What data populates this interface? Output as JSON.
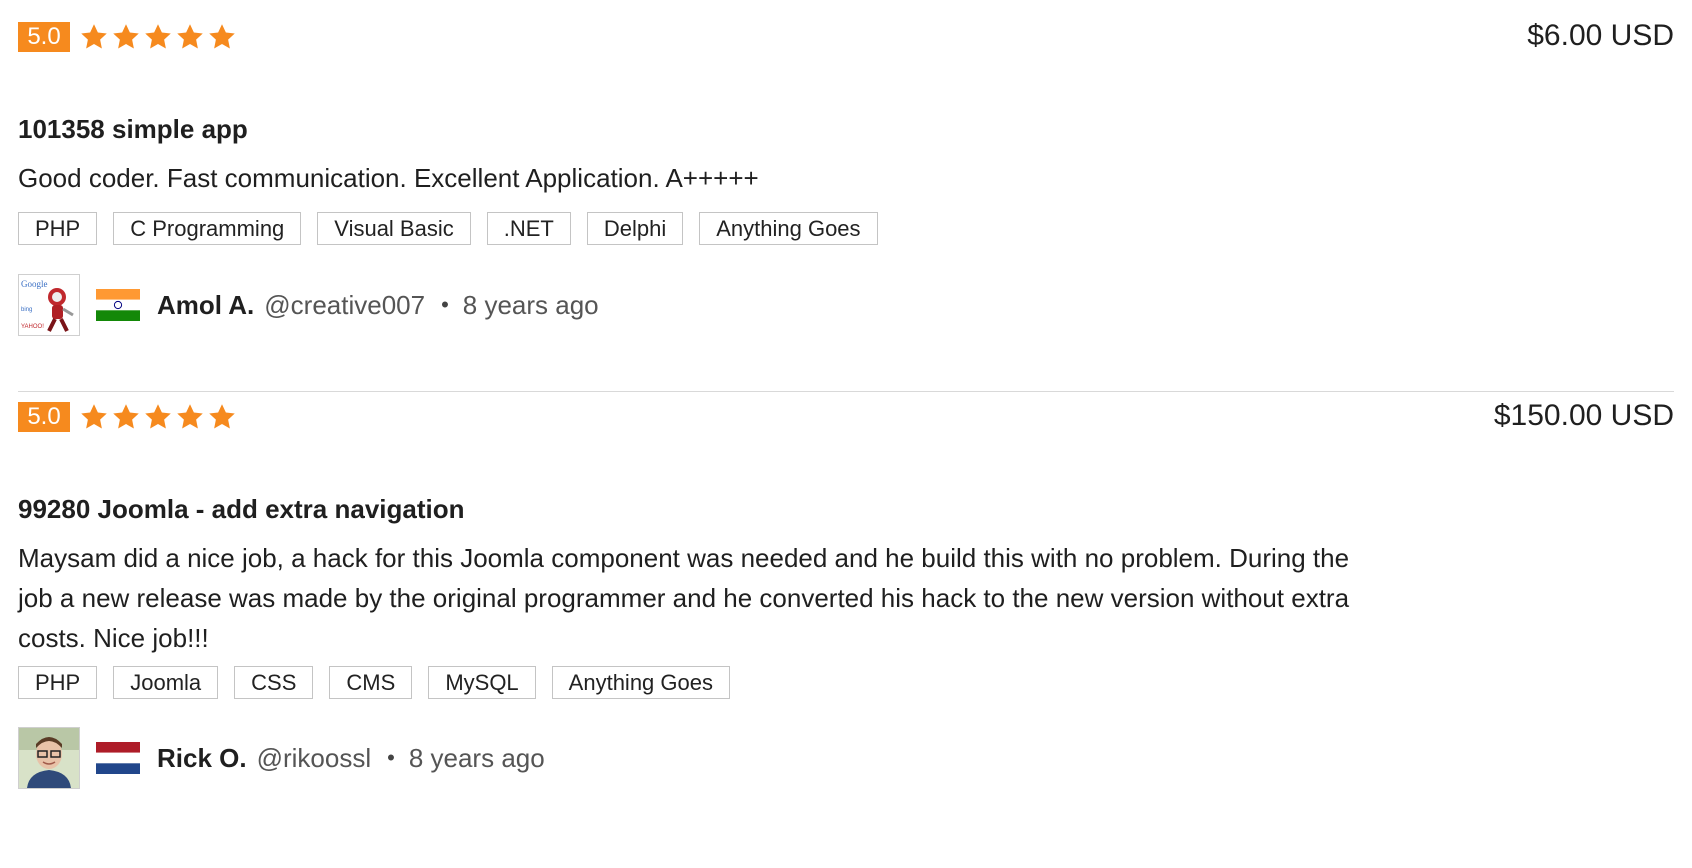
{
  "colors": {
    "accent": "#f68a1e",
    "star": "#f68a1e",
    "tag_border": "#c4c4c4"
  },
  "reviews": [
    {
      "score": "5.0",
      "stars": 5,
      "price": "$6.00 USD",
      "title": "101358 simple app",
      "text": "Good coder. Fast communication. Excellent Application. A+++++",
      "tags": [
        "PHP",
        "C Programming",
        "Visual Basic",
        ".NET",
        "Delphi",
        "Anything Goes"
      ],
      "reviewer": {
        "name": "Amol A.",
        "handle": "@creative007",
        "when": "8 years ago",
        "country_flag": "flag-india",
        "avatar_icon": "robot-search-logos-avatar"
      }
    },
    {
      "score": "5.0",
      "stars": 5,
      "price": "$150.00 USD",
      "title": "99280 Joomla - add extra navigation",
      "text": "Maysam did a nice job, a hack for this Joomla component was needed and he build this with no problem. During the job a new release was made by the original programmer and he converted his hack to the new version without extra costs. Nice job!!!",
      "tags": [
        "PHP",
        "Joomla",
        "CSS",
        "CMS",
        "MySQL",
        "Anything Goes"
      ],
      "reviewer": {
        "name": "Rick O.",
        "handle": "@rikoossl",
        "when": "8 years ago",
        "country_flag": "flag-netherlands",
        "avatar_icon": "man-with-glasses-avatar"
      }
    }
  ],
  "separator": "•"
}
